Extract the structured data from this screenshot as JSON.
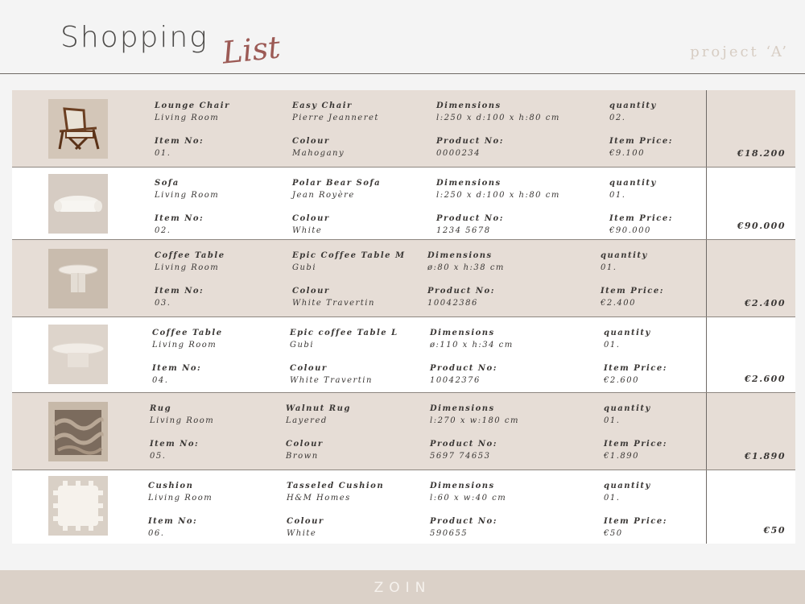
{
  "header": {
    "title": "Shopping",
    "title_script": "List",
    "project": "project ‘A’"
  },
  "items": [
    {
      "item": "Lounge Chair",
      "room": "Living Room",
      "item_no_label": "Item No:",
      "item_no": "01.",
      "name": "Easy Chair",
      "maker": "Pierre Jeanneret",
      "colour_label": "Colour",
      "colour": "Mahogany",
      "dims_label": "Dimensions",
      "dims": "l:250 x d:100 x h:80 cm",
      "product_label": "Product No:",
      "product_no": "0000234",
      "qty_label": "quantity",
      "qty": "02.",
      "price_label": "Item Price:",
      "price": "€9.100",
      "total": "€18.200",
      "icon": "chair-icon"
    },
    {
      "item": "Sofa",
      "room": "Living Room",
      "item_no_label": "Item No:",
      "item_no": "02.",
      "name": "Polar Bear Sofa",
      "maker": "Jean Royère",
      "colour_label": "Colour",
      "colour": "White",
      "dims_label": "Dimensions",
      "dims": "l:250 x d:100 x h:80 cm",
      "product_label": "Product No:",
      "product_no": "1234 5678",
      "qty_label": "quantity",
      "qty": "01.",
      "price_label": "Item Price:",
      "price": "€90.000",
      "total": "€90.000",
      "icon": "sofa-icon"
    },
    {
      "item": "Coffee Table",
      "room": "Living Room",
      "item_no_label": "Item No:",
      "item_no": "03.",
      "name": "Epic Coffee Table M",
      "maker": "Gubi",
      "colour_label": "Colour",
      "colour": "White Travertin",
      "dims_label": "Dimensions",
      "dims": "ø:80 x h:38 cm",
      "product_label": "Product No:",
      "product_no": "10042386",
      "qty_label": "quantity",
      "qty": "01.",
      "price_label": "Item Price:",
      "price": "€2.400",
      "total": "€2.400",
      "icon": "coffee-table-icon"
    },
    {
      "item": "Coffee Table",
      "room": "Living Room",
      "item_no_label": "Item No:",
      "item_no": "04.",
      "name": "Epic coffee Table L",
      "maker": "Gubi",
      "colour_label": "Colour",
      "colour": "White Travertin",
      "dims_label": "Dimensions",
      "dims": "ø:110 x h:34 cm",
      "product_label": "Product No:",
      "product_no": "10042376",
      "qty_label": "quantity",
      "qty": "01.",
      "price_label": "Item Price:",
      "price": "€2.600",
      "total": "€2.600",
      "icon": "coffee-table-icon"
    },
    {
      "item": "Rug",
      "room": "Living Room",
      "item_no_label": "Item No:",
      "item_no": "05.",
      "name": "Walnut Rug",
      "maker": "Layered",
      "colour_label": "Colour",
      "colour": "Brown",
      "dims_label": "Dimensions",
      "dims": "l:270 x w:180 cm",
      "product_label": "Product No:",
      "product_no": "5697 74653",
      "qty_label": "quantity",
      "qty": "01.",
      "price_label": "Item Price:",
      "price": "€1.890",
      "total": "€1.890",
      "icon": "rug-icon"
    },
    {
      "item": "Cushion",
      "room": "Living Room",
      "item_no_label": "Item No:",
      "item_no": "06.",
      "name": "Tasseled Cushion",
      "maker": "H&M Homes",
      "colour_label": "Colour",
      "colour": "White",
      "dims_label": "Dimensions",
      "dims": "l:60 x w:40 cm",
      "product_label": "Product No:",
      "product_no": "590655",
      "qty_label": "quantity",
      "qty": "01.",
      "price_label": "Item Price:",
      "price": "€50",
      "total": "€50",
      "icon": "cushion-icon"
    }
  ],
  "footer": {
    "brand": "ZOIN"
  },
  "colors": {
    "accent_script": "#9c5a55",
    "shaded_row": "#e6ddd6",
    "footer_bg": "#dbd1c8"
  }
}
